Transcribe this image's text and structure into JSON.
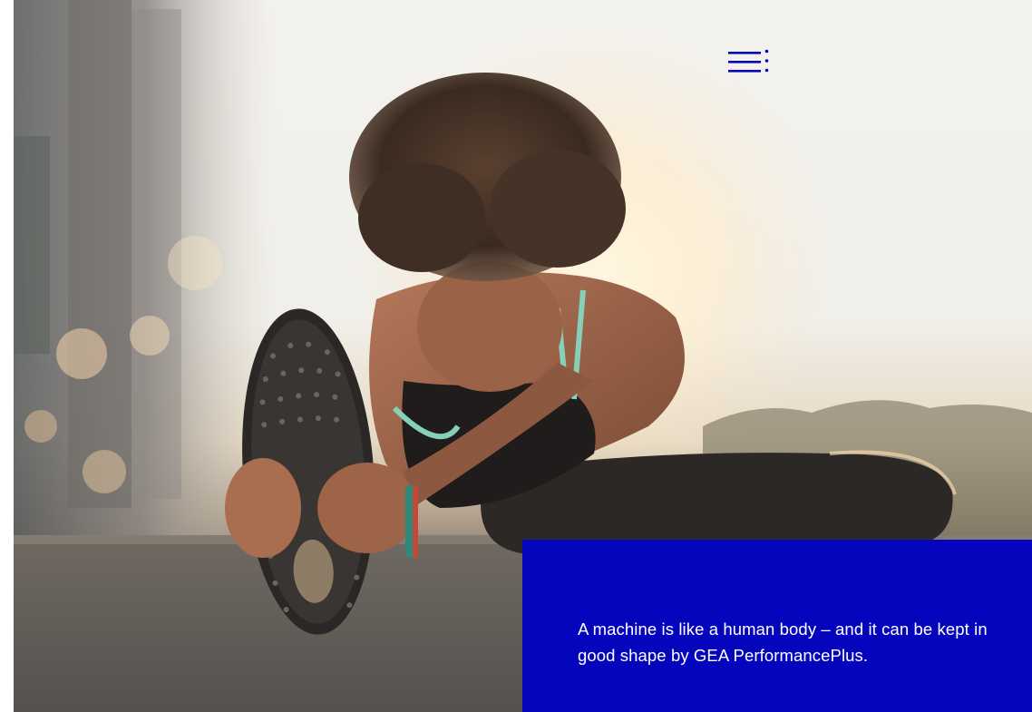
{
  "hero": {
    "image_alt": "Woman stretching outdoors at sunset",
    "icon": "menu-icon"
  },
  "menu": {
    "icon": "menu-dots-icon",
    "color": "#0505bd"
  },
  "tagline": {
    "text": "A machine is like a human body – and it can be kept in good shape by GEA PerformancePlus.",
    "background": "#0505bd",
    "color": "#ffffff"
  }
}
